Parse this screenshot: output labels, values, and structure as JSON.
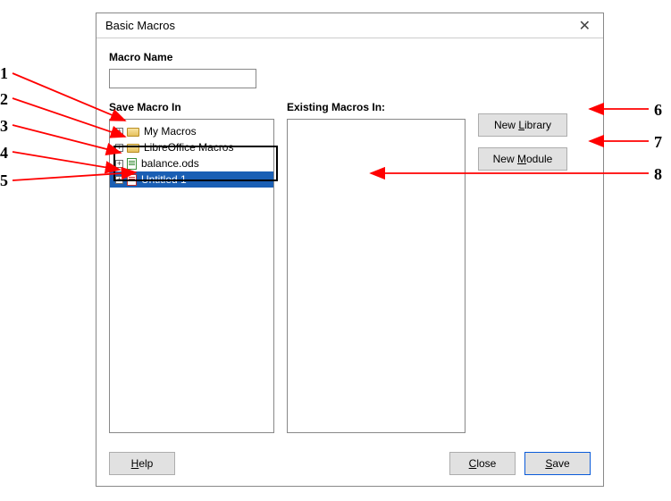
{
  "dialog": {
    "title": "Basic Macros",
    "macroNameLabel": "Macro Name",
    "macroNameValue": "",
    "saveMacroInLabel": "Save Macro In",
    "existingMacrosLabel": "Existing Macros In:"
  },
  "tree": {
    "items": [
      {
        "label": "My Macros",
        "icon": "folder"
      },
      {
        "label": "LibreOffice Macros",
        "icon": "folder"
      },
      {
        "label": "balance.ods",
        "icon": "doc-green"
      },
      {
        "label": "Untitled 1",
        "icon": "doc-red",
        "selected": true
      }
    ]
  },
  "buttons": {
    "newLibrary": {
      "pre": "New ",
      "ul": "L",
      "post": "ibrary"
    },
    "newModule": {
      "pre": "New ",
      "ul": "M",
      "post": "odule"
    },
    "help": {
      "pre": "",
      "ul": "H",
      "post": "elp"
    },
    "close": {
      "pre": "",
      "ul": "C",
      "post": "lose"
    },
    "save": {
      "pre": "",
      "ul": "S",
      "post": "ave"
    }
  },
  "annotations": {
    "n1": "1",
    "n2": "2",
    "n3": "3",
    "n4": "4",
    "n5": "5",
    "n6": "6",
    "n7": "7",
    "n8": "8"
  },
  "arrowColor": "#ff0000"
}
